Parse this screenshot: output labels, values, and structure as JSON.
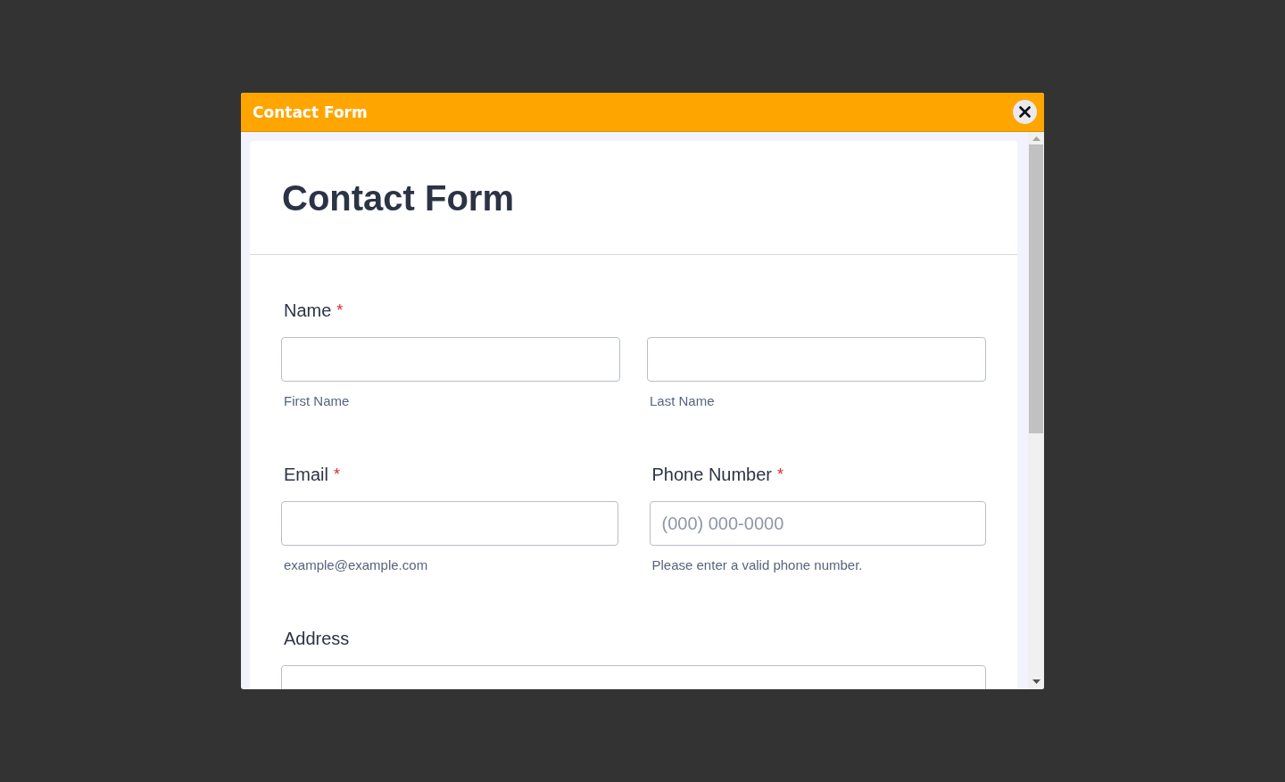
{
  "dialog": {
    "title": "Contact Form"
  },
  "form": {
    "heading": "Contact Form",
    "rows": [
      {
        "fields": [
          {
            "label": "Name",
            "required_mark": "*",
            "inputs": [
              {
                "sublabel": "First Name"
              },
              {
                "sublabel": "Last Name"
              }
            ]
          }
        ]
      },
      {
        "fields": [
          {
            "label": "Email",
            "required_mark": "*",
            "inputs": [
              {
                "sublabel": "example@example.com"
              }
            ]
          },
          {
            "label": "Phone Number",
            "required_mark": "*",
            "inputs": [
              {
                "placeholder": "(000) 000-0000",
                "sublabel": "Please enter a valid phone number."
              }
            ]
          }
        ]
      },
      {
        "fields": [
          {
            "label": "Address"
          }
        ]
      }
    ]
  }
}
